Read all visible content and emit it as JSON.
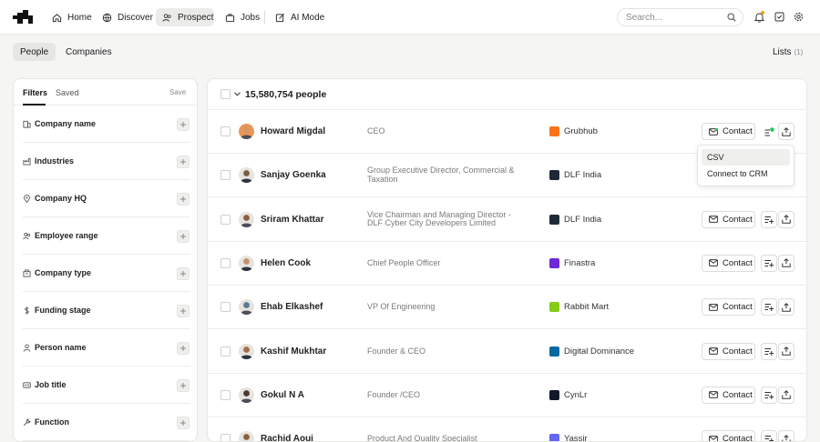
{
  "nav": {
    "home": "Home",
    "discover": "Discover",
    "prospect": "Prospect",
    "jobs": "Jobs",
    "ai_mode": "AI Mode"
  },
  "search": {
    "placeholder": "Search..."
  },
  "subtabs": {
    "people": "People",
    "companies": "Companies"
  },
  "lists": {
    "label": "Lists",
    "count": "(1)"
  },
  "filters": {
    "tab_filters": "Filters",
    "tab_saved": "Saved",
    "save": "Save",
    "items": [
      {
        "label": "Company name",
        "icon": "building-icon"
      },
      {
        "label": "Industries",
        "icon": "factory-icon"
      },
      {
        "label": "Company HQ",
        "icon": "map-pin-icon"
      },
      {
        "label": "Employee range",
        "icon": "users-icon"
      },
      {
        "label": "Company type",
        "icon": "building-type-icon"
      },
      {
        "label": "Funding stage",
        "icon": "dollar-icon"
      },
      {
        "label": "Person name",
        "icon": "person-icon"
      },
      {
        "label": "Job title",
        "icon": "badge-icon"
      },
      {
        "label": "Function",
        "icon": "wrench-icon"
      }
    ]
  },
  "results": {
    "count": "15,580,754 people",
    "contact_label": "Contact",
    "rows": [
      {
        "name": "Howard Migdal",
        "title": "CEO",
        "company": "Grubhub",
        "logo_color": "#f97316"
      },
      {
        "name": "Sanjay Goenka",
        "title": "Group Executive Director, Commercial & Taxation",
        "company": "DLF India",
        "logo_color": "#1f2937"
      },
      {
        "name": "Sriram Khattar",
        "title": "Vice Chairman and Managing Director - DLF Cyber City Developers Limited",
        "company": "DLF India",
        "logo_color": "#1f2937"
      },
      {
        "name": "Helen Cook",
        "title": "Chief People Officer",
        "company": "Finastra",
        "logo_color": "#6d28d9"
      },
      {
        "name": "Ehab Elkashef",
        "title": "VP Of Engineering",
        "company": "Rabbit Mart",
        "logo_color": "#84cc16"
      },
      {
        "name": "Kashif Mukhtar",
        "title": "Founder & CEO",
        "company": "Digital Dominance",
        "logo_color": "#0369a1"
      },
      {
        "name": "Gokul N A",
        "title": "Founder /CEO",
        "company": "CynLr",
        "logo_color": "#111827"
      },
      {
        "name": "Rachid Aoui",
        "title": "Product And Quality Specialist",
        "company": "Yassir",
        "logo_color": "#6366f1"
      }
    ]
  },
  "export_menu": {
    "items": [
      "CSV",
      "Connect to CRM"
    ]
  },
  "colors": {
    "accent": "#1c1c1c",
    "notification": "#f59e0b",
    "enriched": "#22c55e"
  }
}
